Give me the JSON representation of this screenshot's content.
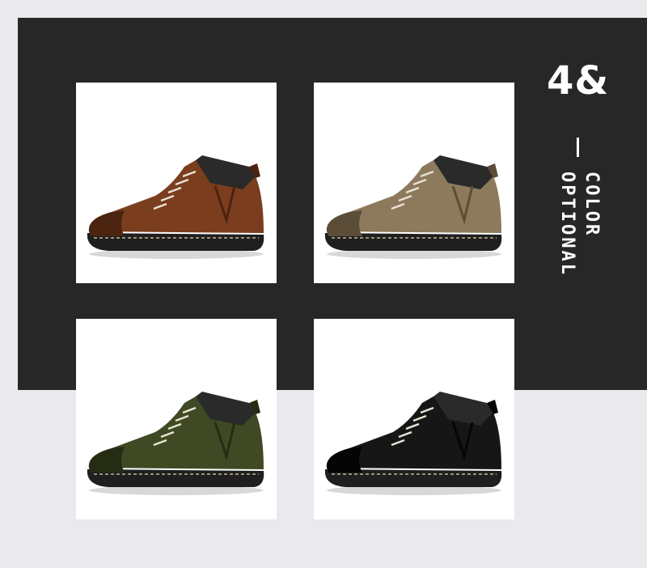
{
  "headline": "4&",
  "vertical_caption": {
    "line1": "COLOR",
    "line2": "OPTIONAL"
  },
  "products": [
    {
      "name": "brown-boot",
      "color": "#7a3d1e",
      "accent": "#4b2410"
    },
    {
      "name": "khaki-boot",
      "color": "#8d7a5c",
      "accent": "#5b4d37"
    },
    {
      "name": "army-green-boot",
      "color": "#3f4a24",
      "accent": "#262c14"
    },
    {
      "name": "black-boot",
      "color": "#161616",
      "accent": "#050505"
    }
  ],
  "colors": {
    "dark_band": "#272727",
    "page_bg": "#eaeaee",
    "text": "#ffffff"
  }
}
